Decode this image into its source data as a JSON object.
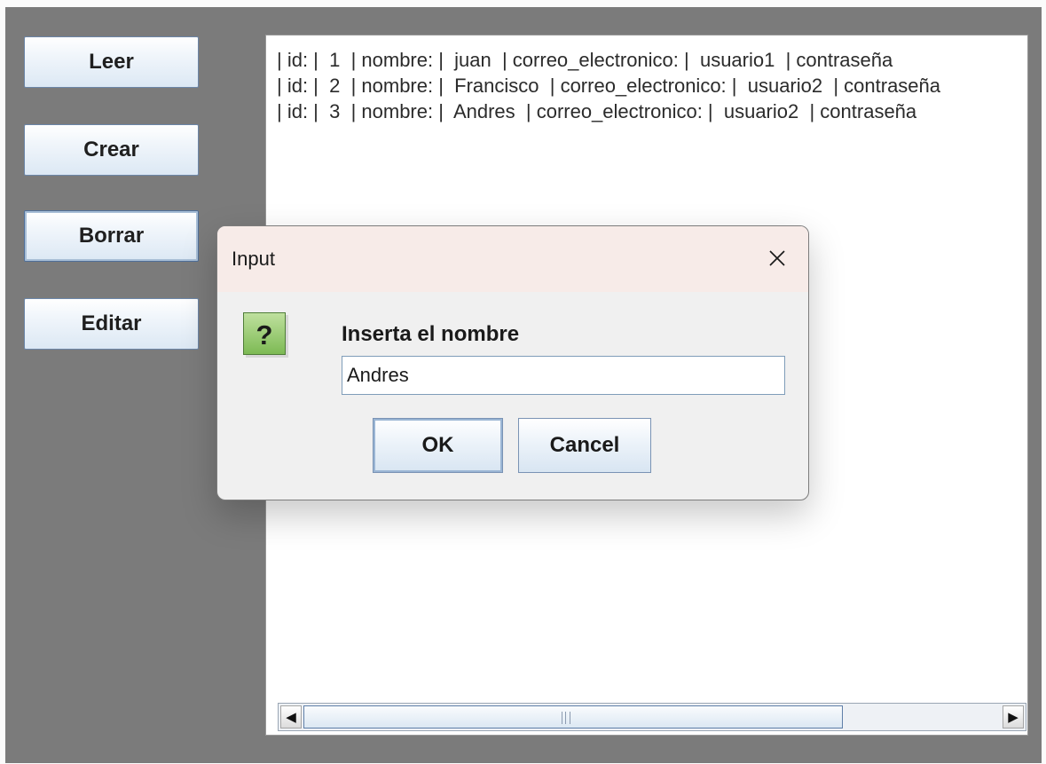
{
  "sidebar": {
    "buttons": [
      {
        "label": "Leer"
      },
      {
        "label": "Crear"
      },
      {
        "label": "Borrar"
      },
      {
        "label": "Editar"
      }
    ]
  },
  "output": {
    "lines": [
      "| id: |  1  | nombre: |  juan  | correo_electronico: |  usuario1  | contraseña",
      "| id: |  2  | nombre: |  Francisco  | correo_electronico: |  usuario2  | contraseña",
      "| id: |  3  | nombre: |  Andres  | correo_electronico: |  usuario2  | contraseña"
    ]
  },
  "scrollbar": {
    "left_icon": "arrow-left-icon",
    "right_icon": "arrow-right-icon"
  },
  "dialog": {
    "title": "Input",
    "close_icon": "close-icon",
    "question_icon": "question-icon",
    "question_mark": "?",
    "prompt": "Inserta el nombre",
    "input_value": "Andres",
    "ok_label": "OK",
    "cancel_label": "Cancel"
  }
}
